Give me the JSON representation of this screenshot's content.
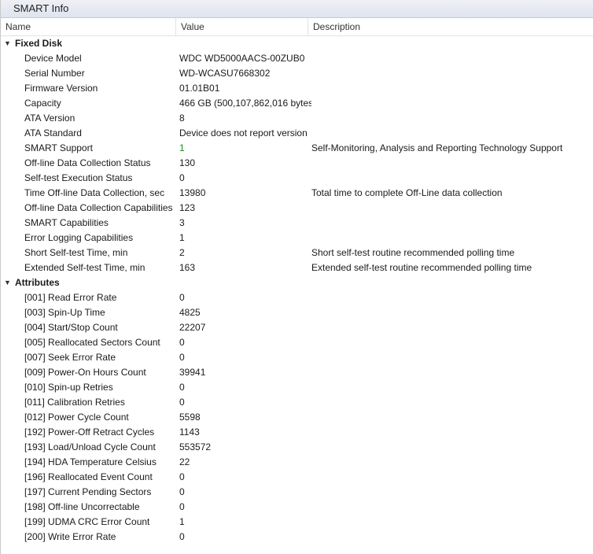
{
  "window": {
    "title": "SMART Info"
  },
  "columns": {
    "name": "Name",
    "value": "Value",
    "description": "Description"
  },
  "accent_colors": {
    "good_value": "#1a8a1a",
    "title_bar": "#dfe4ee"
  },
  "groups": [
    {
      "label": "Fixed Disk",
      "toggle_icon": "chevron-down-icon",
      "rows": [
        {
          "name": "Device Model",
          "value": "WDC WD5000AACS-00ZUB0",
          "desc": ""
        },
        {
          "name": "Serial Number",
          "value": "WD-WCASU7668302",
          "desc": ""
        },
        {
          "name": "Firmware Version",
          "value": "01.01B01",
          "desc": ""
        },
        {
          "name": "Capacity",
          "value": "466 GB (500,107,862,016 bytes)",
          "desc": ""
        },
        {
          "name": "ATA Version",
          "value": "8",
          "desc": ""
        },
        {
          "name": "ATA Standard",
          "value": "Device does not report version",
          "desc": ""
        },
        {
          "name": "SMART Support",
          "value": "1",
          "desc": "Self-Monitoring, Analysis and Reporting Technology Support",
          "green": true
        },
        {
          "name": "Off-line Data Collection Status",
          "value": "130",
          "desc": ""
        },
        {
          "name": "Self-test Execution Status",
          "value": "0",
          "desc": ""
        },
        {
          "name": "Time Off-line Data Collection, sec",
          "value": "13980",
          "desc": "Total time to complete Off-Line data collection"
        },
        {
          "name": "Off-line Data Collection Capabilities",
          "value": "123",
          "desc": ""
        },
        {
          "name": "SMART Capabilities",
          "value": "3",
          "desc": ""
        },
        {
          "name": "Error Logging Capabilities",
          "value": "1",
          "desc": ""
        },
        {
          "name": "Short Self-test Time, min",
          "value": "2",
          "desc": "Short self-test routine recommended polling time"
        },
        {
          "name": "Extended Self-test Time, min",
          "value": "163",
          "desc": "Extended self-test routine recommended polling time"
        }
      ]
    },
    {
      "label": "Attributes",
      "toggle_icon": "chevron-down-icon",
      "rows": [
        {
          "name": "[001] Read Error Rate",
          "value": "0",
          "desc": ""
        },
        {
          "name": "[003] Spin-Up Time",
          "value": "4825",
          "desc": ""
        },
        {
          "name": "[004] Start/Stop Count",
          "value": "22207",
          "desc": ""
        },
        {
          "name": "[005] Reallocated Sectors Count",
          "value": "0",
          "desc": ""
        },
        {
          "name": "[007] Seek Error Rate",
          "value": "0",
          "desc": ""
        },
        {
          "name": "[009] Power-On Hours Count",
          "value": "39941",
          "desc": ""
        },
        {
          "name": "[010] Spin-up Retries",
          "value": "0",
          "desc": ""
        },
        {
          "name": "[011] Calibration Retries",
          "value": "0",
          "desc": ""
        },
        {
          "name": "[012] Power Cycle Count",
          "value": "5598",
          "desc": ""
        },
        {
          "name": "[192] Power-Off Retract Cycles",
          "value": "1143",
          "desc": ""
        },
        {
          "name": "[193] Load/Unload Cycle Count",
          "value": "553572",
          "desc": ""
        },
        {
          "name": "[194] HDA Temperature Celsius",
          "value": "22",
          "desc": ""
        },
        {
          "name": "[196] Reallocated Event Count",
          "value": "0",
          "desc": ""
        },
        {
          "name": "[197] Current Pending Sectors",
          "value": "0",
          "desc": ""
        },
        {
          "name": "[198] Off-line Uncorrectable",
          "value": "0",
          "desc": ""
        },
        {
          "name": "[199] UDMA CRC Error Count",
          "value": "1",
          "desc": ""
        },
        {
          "name": "[200] Write Error Rate",
          "value": "0",
          "desc": ""
        }
      ]
    }
  ]
}
